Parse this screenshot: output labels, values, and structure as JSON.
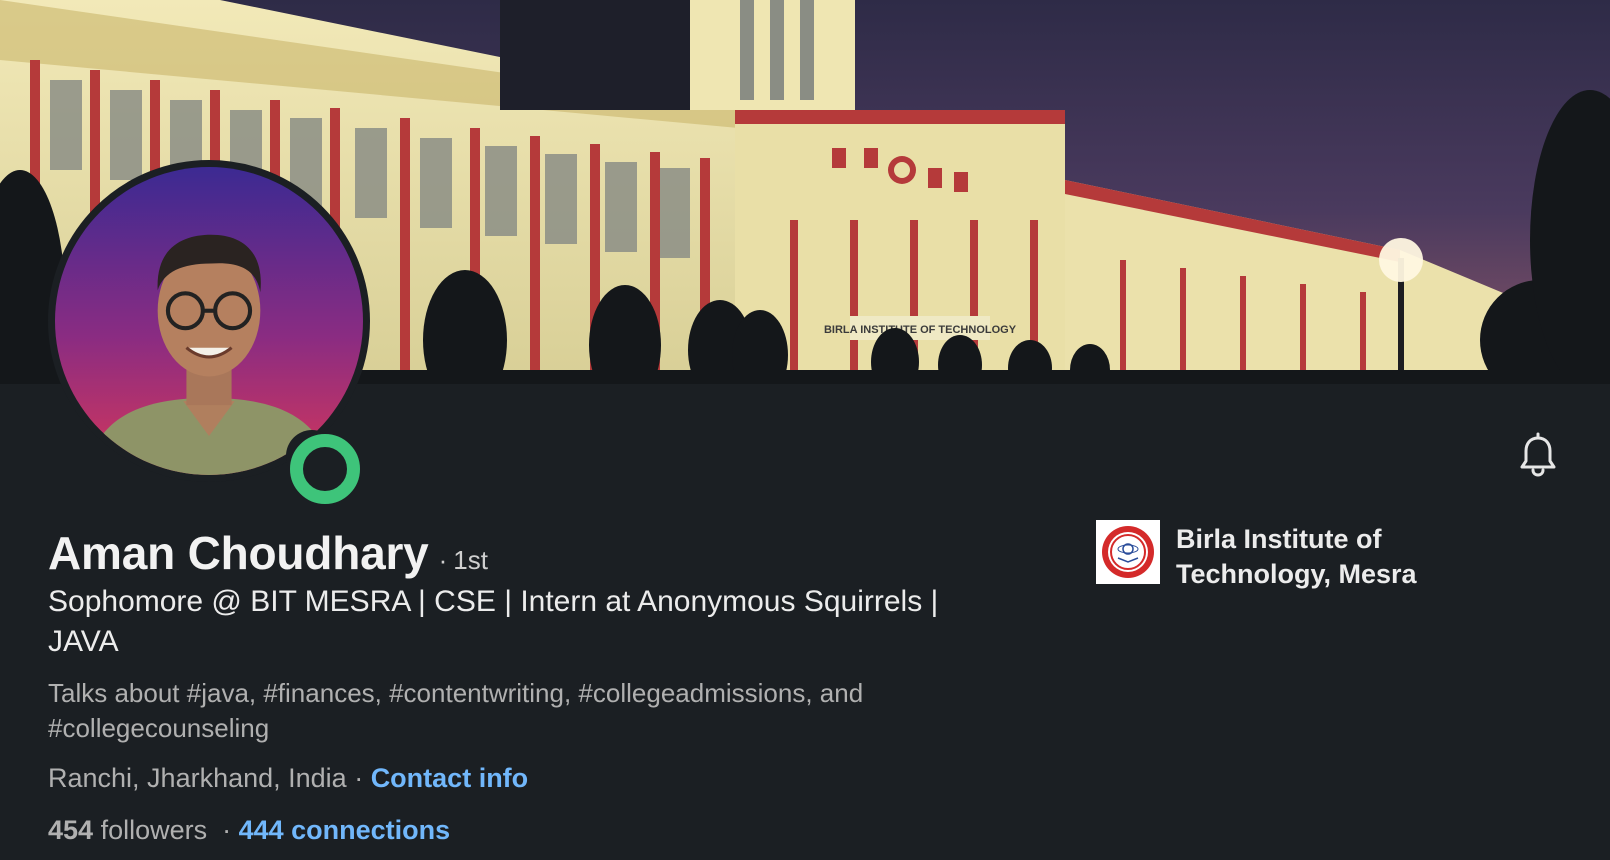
{
  "profile": {
    "name": "Aman Choudhary",
    "degree_separator": "·",
    "degree": "1st",
    "headline": "Sophomore @ BIT MESRA | CSE | Intern at Anonymous Squirrels | JAVA",
    "talks_about": "Talks about #java, #finances, #contentwriting, #collegeadmissions, and #collegecounseling",
    "location": "Ranchi, Jharkhand, India",
    "location_separator": " · ",
    "contact_info_label": "Contact info",
    "followers_count": "454",
    "followers_label": " followers",
    "stats_separator": "  · ",
    "connections_label": "444 connections",
    "online_status_color": "#3ec47a"
  },
  "education": {
    "name": "Birla Institute of Technology, Mesra"
  },
  "cover": {
    "building_sign": "BIRLA INSTITUTE OF TECHNOLOGY"
  },
  "icons": {
    "bell": "bell-icon",
    "online": "online-status-icon",
    "org_logo": "university-seal-icon"
  },
  "colors": {
    "background": "#1b1f23",
    "link": "#71b7fb",
    "muted_text": "#b0b0b0",
    "primary_text": "#ececec"
  }
}
